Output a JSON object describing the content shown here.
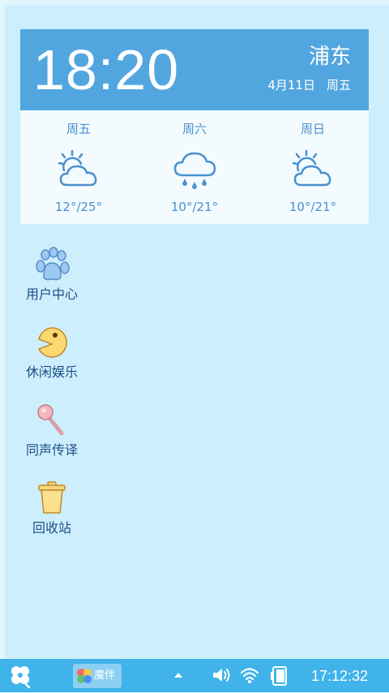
{
  "weather": {
    "time": "18:20",
    "city": "浦东",
    "date": "4月11日",
    "weekday": "周五",
    "forecast": [
      {
        "day": "周五",
        "icon": "partly-cloudy-sun-icon",
        "temp": "12°/25°"
      },
      {
        "day": "周六",
        "icon": "rain-cloud-icon",
        "temp": "10°/21°"
      },
      {
        "day": "周日",
        "icon": "partly-cloudy-sun-icon",
        "temp": "10°/21°"
      }
    ]
  },
  "desktop": {
    "icons": [
      {
        "label": "用户中心",
        "icon": "paw-icon"
      },
      {
        "label": "休闲娱乐",
        "icon": "pacman-icon"
      },
      {
        "label": "同声传译",
        "icon": "microphone-icon"
      },
      {
        "label": "回收站",
        "icon": "trash-bin-icon"
      }
    ]
  },
  "taskbar": {
    "start_icon": "clover-icon",
    "app_label": "魔伴",
    "clock": "17:12:32"
  },
  "colors": {
    "background": "#cdeefd",
    "widget_header": "#52a6e0",
    "taskbar": "#3fb3ea",
    "icon_label": "#1d4f86",
    "forecast_text": "#4a90cf"
  }
}
